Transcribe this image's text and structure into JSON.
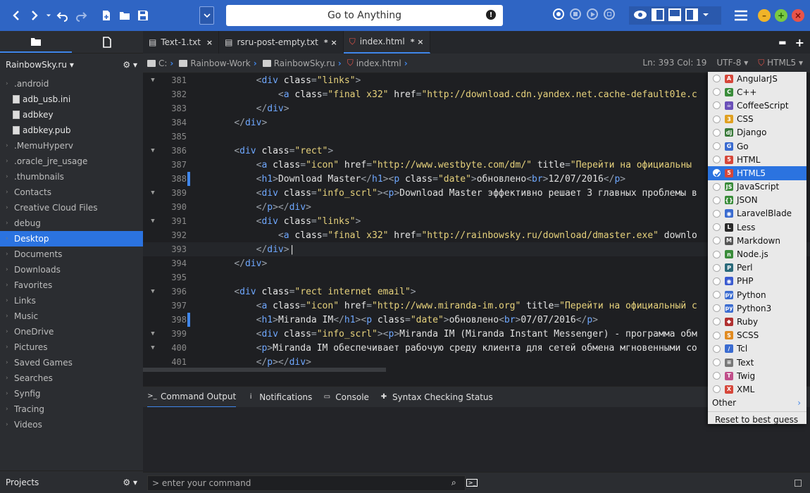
{
  "toolbar": {
    "goto_placeholder": "Go to Anything"
  },
  "left": {
    "places_label": "RainbowSky.ru ▾",
    "items": [
      {
        "label": ".android",
        "type": "folder"
      },
      {
        "label": "adb_usb.ini",
        "type": "file"
      },
      {
        "label": "adbkey",
        "type": "file"
      },
      {
        "label": "adbkey.pub",
        "type": "file"
      },
      {
        "label": ".MemuHyperv",
        "type": "folder"
      },
      {
        "label": ".oracle_jre_usage",
        "type": "folder"
      },
      {
        "label": ".thumbnails",
        "type": "folder"
      },
      {
        "label": "Contacts",
        "type": "folder"
      },
      {
        "label": "Creative Cloud Files",
        "type": "folder"
      },
      {
        "label": "debug",
        "type": "folder"
      },
      {
        "label": "Desktop",
        "type": "folder",
        "selected": true
      },
      {
        "label": "Documents",
        "type": "folder"
      },
      {
        "label": "Downloads",
        "type": "folder"
      },
      {
        "label": "Favorites",
        "type": "folder"
      },
      {
        "label": "Links",
        "type": "folder"
      },
      {
        "label": "Music",
        "type": "folder"
      },
      {
        "label": "OneDrive",
        "type": "folder"
      },
      {
        "label": "Pictures",
        "type": "folder"
      },
      {
        "label": "Saved Games",
        "type": "folder"
      },
      {
        "label": "Searches",
        "type": "folder"
      },
      {
        "label": "Synfig",
        "type": "folder"
      },
      {
        "label": "Tracing",
        "type": "folder"
      },
      {
        "label": "Videos",
        "type": "folder"
      }
    ],
    "projects_label": "Projects"
  },
  "tabs": [
    {
      "label": "Text-1.txt",
      "modified": "×"
    },
    {
      "label": "rsru-post-empty.txt",
      "modified": "*  ×"
    },
    {
      "label": "index.html",
      "modified": "*  ×",
      "active": true
    }
  ],
  "crumbs": [
    "C:",
    "Rainbow-Work",
    "RainbowSky.ru",
    "index.html"
  ],
  "status": {
    "pos": "Ln: 393 Col: 19",
    "encoding": "UTF-8 ▾",
    "lang": "HTML5 ▾"
  },
  "code": [
    {
      "n": "381",
      "fold": true,
      "m": false,
      "html": "        <span class='p'>&lt;</span><span class='t'>div</span> <span class='a'>class</span><span class='p'>=</span><span class='s'>\"links\"</span><span class='p'>&gt;</span>"
    },
    {
      "n": "382",
      "fold": false,
      "m": false,
      "html": "            <span class='p'>&lt;</span><span class='t'>a</span> <span class='a'>class</span><span class='p'>=</span><span class='s'>\"final x32\"</span> <span class='a'>href</span><span class='p'>=</span><span class='s'>\"http://download.cdn.yandex.net.cache-default01e.c</span>"
    },
    {
      "n": "383",
      "fold": false,
      "m": false,
      "html": "        <span class='p'>&lt;/</span><span class='t'>div</span><span class='p'>&gt;</span>"
    },
    {
      "n": "384",
      "fold": false,
      "m": false,
      "html": "    <span class='p'>&lt;/</span><span class='t'>div</span><span class='p'>&gt;</span>"
    },
    {
      "n": "385",
      "fold": false,
      "m": false,
      "html": ""
    },
    {
      "n": "386",
      "fold": true,
      "m": false,
      "html": "    <span class='p'>&lt;</span><span class='t'>div</span> <span class='a'>class</span><span class='p'>=</span><span class='s'>\"rect\"</span><span class='p'>&gt;</span>"
    },
    {
      "n": "387",
      "fold": false,
      "m": false,
      "html": "        <span class='p'>&lt;</span><span class='t'>a</span> <span class='a'>class</span><span class='p'>=</span><span class='s'>\"icon\"</span> <span class='a'>href</span><span class='p'>=</span><span class='s'>\"http://www.westbyte.com/dm/\"</span> <span class='a'>title</span><span class='p'>=</span><span class='s'>\"Перейти на официальны</span>"
    },
    {
      "n": "388",
      "fold": false,
      "m": true,
      "html": "        <span class='p'>&lt;</span><span class='t'>h1</span><span class='p'>&gt;</span>Download Master<span class='p'>&lt;/</span><span class='t'>h1</span><span class='p'>&gt;&lt;</span><span class='t'>p</span> <span class='a'>class</span><span class='p'>=</span><span class='s'>\"date\"</span><span class='p'>&gt;</span>обновлено<span class='p'>&lt;</span><span class='t'>br</span><span class='p'>&gt;</span>12/07/2016<span class='p'>&lt;/</span><span class='t'>p</span><span class='p'>&gt;</span>"
    },
    {
      "n": "389",
      "fold": true,
      "m": false,
      "html": "        <span class='p'>&lt;</span><span class='t'>div</span> <span class='a'>class</span><span class='p'>=</span><span class='s'>\"info_scrl\"</span><span class='p'>&gt;&lt;</span><span class='t'>p</span><span class='p'>&gt;</span>Download Master эффективно решает 3 главных проблемы в"
    },
    {
      "n": "390",
      "fold": false,
      "m": false,
      "html": "        <span class='p'>&lt;/</span><span class='t'>p</span><span class='p'>&gt;&lt;/</span><span class='t'>div</span><span class='p'>&gt;</span>"
    },
    {
      "n": "391",
      "fold": true,
      "m": false,
      "html": "        <span class='p'>&lt;</span><span class='t'>div</span> <span class='a'>class</span><span class='p'>=</span><span class='s'>\"links\"</span><span class='p'>&gt;</span>"
    },
    {
      "n": "392",
      "fold": false,
      "m": false,
      "html": "            <span class='p'>&lt;</span><span class='t'>a</span> <span class='a'>class</span><span class='p'>=</span><span class='s'>\"final x32\"</span> <span class='a'>href</span><span class='p'>=</span><span class='s'>\"http://rainbowsky.ru/download/dmaster.exe\"</span> downlo"
    },
    {
      "n": "393",
      "fold": false,
      "m": false,
      "cur": true,
      "html": "        <span class='p'>&lt;/</span><span class='t'>div</span><span class='p'>&gt;</span>|"
    },
    {
      "n": "394",
      "fold": false,
      "m": false,
      "html": "    <span class='p'>&lt;/</span><span class='t'>div</span><span class='p'>&gt;</span>"
    },
    {
      "n": "395",
      "fold": false,
      "m": false,
      "html": ""
    },
    {
      "n": "396",
      "fold": true,
      "m": false,
      "html": "    <span class='p'>&lt;</span><span class='t'>div</span> <span class='a'>class</span><span class='p'>=</span><span class='s'>\"rect internet email\"</span><span class='p'>&gt;</span>"
    },
    {
      "n": "397",
      "fold": false,
      "m": false,
      "html": "        <span class='p'>&lt;</span><span class='t'>a</span> <span class='a'>class</span><span class='p'>=</span><span class='s'>\"icon\"</span> <span class='a'>href</span><span class='p'>=</span><span class='s'>\"http://www.miranda-im.org\"</span> <span class='a'>title</span><span class='p'>=</span><span class='s'>\"Перейти на официальный с</span>"
    },
    {
      "n": "398",
      "fold": false,
      "m": true,
      "html": "        <span class='p'>&lt;</span><span class='t'>h1</span><span class='p'>&gt;</span>Miranda IM<span class='p'>&lt;/</span><span class='t'>h1</span><span class='p'>&gt;&lt;</span><span class='t'>p</span> <span class='a'>class</span><span class='p'>=</span><span class='s'>\"date\"</span><span class='p'>&gt;</span>обновлено<span class='p'>&lt;</span><span class='t'>br</span><span class='p'>&gt;</span>07/07/2016<span class='p'>&lt;/</span><span class='t'>p</span><span class='p'>&gt;</span>"
    },
    {
      "n": "399",
      "fold": true,
      "m": false,
      "html": "        <span class='p'>&lt;</span><span class='t'>div</span> <span class='a'>class</span><span class='p'>=</span><span class='s'>\"info_scrl\"</span><span class='p'>&gt;&lt;</span><span class='t'>p</span><span class='p'>&gt;</span>Miranda IM (Miranda Instant Messenger) - программа обм"
    },
    {
      "n": "400",
      "fold": true,
      "m": false,
      "html": "        <span class='p'>&lt;</span><span class='t'>p</span><span class='p'>&gt;</span>Miranda IM обеспечивает рабочую среду клиента для сетей обмена мгновенными со"
    },
    {
      "n": "401",
      "fold": false,
      "m": false,
      "html": "        <span class='p'>&lt;/</span><span class='t'>p</span><span class='p'>&gt;&lt;/</span><span class='t'>div</span><span class='p'>&gt;</span>"
    }
  ],
  "bottom_tabs": [
    {
      "label": "Command Output",
      "icon": ">_",
      "active": true
    },
    {
      "label": "Notifications",
      "icon": "i"
    },
    {
      "label": "Console",
      "icon": "▭"
    },
    {
      "label": "Syntax Checking Status",
      "icon": "✚"
    }
  ],
  "command": {
    "placeholder": "> enter your command"
  },
  "languages": [
    {
      "label": "AngularJS",
      "color": "#d6473a",
      "glyph": "A"
    },
    {
      "label": "C++",
      "color": "#3a8c3a",
      "glyph": "C"
    },
    {
      "label": "CoffeeScript",
      "color": "#6a4fb8",
      "glyph": "☕"
    },
    {
      "label": "CSS",
      "color": "#e0a020",
      "glyph": "3"
    },
    {
      "label": "Django",
      "color": "#3a7a3a",
      "glyph": "dj"
    },
    {
      "label": "Go",
      "color": "#3a6bd0",
      "glyph": "G"
    },
    {
      "label": "HTML",
      "color": "#d6473a",
      "glyph": "5"
    },
    {
      "label": "HTML5",
      "color": "#d6473a",
      "glyph": "5",
      "selected": true
    },
    {
      "label": "JavaScript",
      "color": "#3a8c3a",
      "glyph": "JS"
    },
    {
      "label": "JSON",
      "color": "#3a8c3a",
      "glyph": "{}"
    },
    {
      "label": "LaravelBlade",
      "color": "#3a6bd0",
      "glyph": "◉"
    },
    {
      "label": "Less",
      "color": "#2a2a2a",
      "glyph": "L"
    },
    {
      "label": "Markdown",
      "color": "#555555",
      "glyph": "M"
    },
    {
      "label": "Node.js",
      "color": "#3a8c3a",
      "glyph": "n"
    },
    {
      "label": "Perl",
      "color": "#2a6a7a",
      "glyph": "P"
    },
    {
      "label": "PHP",
      "color": "#3a5ad0",
      "glyph": "◉"
    },
    {
      "label": "Python",
      "color": "#3a6bd0",
      "glyph": "py"
    },
    {
      "label": "Python3",
      "color": "#3a6bd0",
      "glyph": "py"
    },
    {
      "label": "Ruby",
      "color": "#b03030",
      "glyph": "◆"
    },
    {
      "label": "SCSS",
      "color": "#e08a20",
      "glyph": "S"
    },
    {
      "label": "Tcl",
      "color": "#3a6bd0",
      "glyph": "/"
    },
    {
      "label": "Text",
      "color": "#777777",
      "glyph": "≡"
    },
    {
      "label": "Twig",
      "color": "#c04f8a",
      "glyph": "T"
    },
    {
      "label": "XML",
      "color": "#d6473a",
      "glyph": "X"
    }
  ],
  "lang_other": "Other",
  "lang_reset": "Reset to best guess"
}
